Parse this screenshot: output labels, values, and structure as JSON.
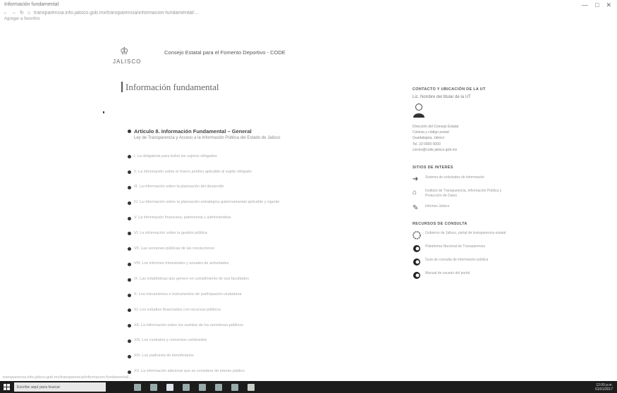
{
  "browser": {
    "tab_title": "Información fundamental",
    "url": "transparencia.info.jalisco.gob.mx/transparencia/informacion-fundamental/...",
    "bookmarks": "Agregar a favoritos",
    "window_controls": [
      "—",
      "□",
      "✕"
    ]
  },
  "header": {
    "logo_text": "JALISCO",
    "org_title": "Consejo Estatal para el Fomento Deportivo - CODE"
  },
  "main": {
    "section_title": "Información fundamental",
    "article_title": "Artículo 8. Información Fundamental – General",
    "article_sub": "Ley de Transparencia y Acceso a la Información Pública del Estado de Jalisco",
    "items": [
      "I. La obligatoria para todos los sujetos obligados",
      "II. La información sobre el marco jurídico aplicable al sujeto obligado",
      "III. La información sobre la planeación del desarrollo",
      "IV. La información sobre la planeación estratégica gubernamental aplicable y vigente",
      "V. La información financiera, patrimonial y administrativa",
      "VI. La información sobre la gestión pública",
      "VII. Las versiones públicas de las resoluciones",
      "VIII. Los informes trimestrales y anuales de actividades",
      "IX. Las estadísticas que genere en cumplimiento de sus facultades",
      "X. Los mecanismos e instrumentos de participación ciudadana",
      "XI. Los estudios financiados con recursos públicos",
      "XII. La información sobre los sueldos de los servidores públicos",
      "XIII. Los contratos y convenios celebrados",
      "XIV. Los padrones de beneficiarios",
      "XV. La información adicional que se considere de interés público"
    ]
  },
  "sidebar": {
    "contact_heading": "CONTACTO Y UBICACIÓN DE LA UT",
    "contact_name": "Lic. Nombre del titular de la UT",
    "contact_lines": [
      "Dirección del Consejo Estatal",
      "Colonia y código postal",
      "Guadalajara, Jalisco",
      "Tel. 33 0000 0000",
      "correo@code.jalisco.gob.mx"
    ],
    "interest_heading": "SITIOS DE INTERÉS",
    "interest": [
      {
        "icon": "pointer-icon",
        "text": "Sistema de solicitudes de información"
      },
      {
        "icon": "building-icon",
        "text": "Instituto de Transparencia, Información Pública y Protección de Datos"
      },
      {
        "icon": "document-icon",
        "text": "Infomex Jalisco"
      }
    ],
    "resources_heading": "RECURSOS DE CONSULTA",
    "resources": [
      {
        "icon": "seal-icon",
        "text": "Gobierno de Jalisco, portal de transparencia estatal"
      },
      {
        "icon": "circle-icon",
        "text": "Plataforma Nacional de Transparencia"
      },
      {
        "icon": "circle-icon",
        "text": "Guía de consulta de información pública"
      },
      {
        "icon": "circle-icon",
        "text": "Manual de usuario del portal"
      }
    ]
  },
  "status_bar": {
    "url": "transparencia.info.jalisco.gob.mx/transparencia/informacion-fundamental/..."
  },
  "taskbar": {
    "search_placeholder": "Escribe aquí para buscar",
    "time": "12:00 p.m.",
    "date": "01/01/2017"
  }
}
